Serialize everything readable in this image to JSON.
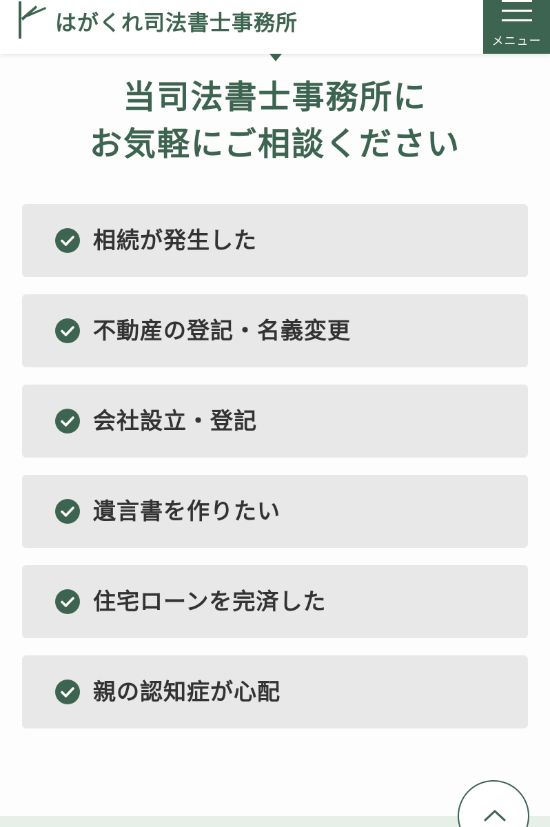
{
  "header": {
    "logo_text": "はがくれ司法書士事務所",
    "logo_icon": "bamboo-logo-icon",
    "menu_label": "メニュー",
    "menu_icon": "hamburger-icon"
  },
  "heading": {
    "line1": "当司法書士事務所に",
    "line2": "お気軽にご相談ください"
  },
  "items": [
    {
      "label": "相続が発生した",
      "icon": "check-circle-icon"
    },
    {
      "label": "不動産の登記・名義変更",
      "icon": "check-circle-icon"
    },
    {
      "label": "会社設立・登記",
      "icon": "check-circle-icon"
    },
    {
      "label": "遺言書を作りたい",
      "icon": "check-circle-icon"
    },
    {
      "label": "住宅ローンを完済した",
      "icon": "check-circle-icon"
    },
    {
      "label": "親の認知症が心配",
      "icon": "check-circle-icon"
    }
  ],
  "scroll_top": {
    "icon": "chevron-up-icon"
  },
  "colors": {
    "brand_green": "#3d6450",
    "item_background": "#e8e8e8",
    "footer_band": "#e6efe8"
  }
}
